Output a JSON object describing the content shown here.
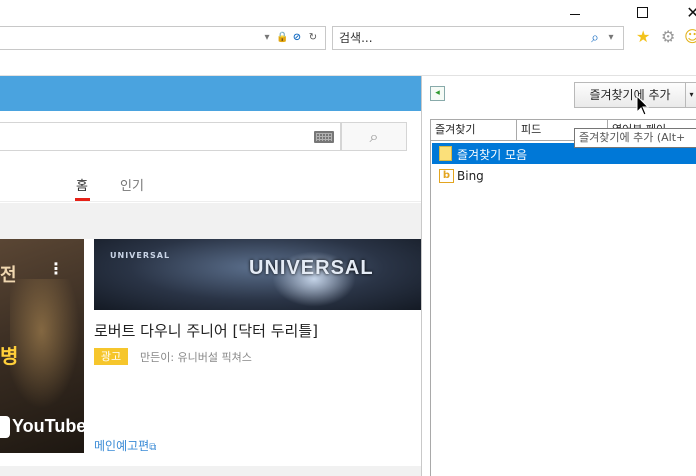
{
  "window": {
    "minimize_icon": "minimize-icon",
    "maximize_icon": "maximize-icon",
    "close_icon": "close-icon",
    "close_glyph": "✕"
  },
  "address_bar": {
    "dropdown_glyph": "▾",
    "lock_glyph": "🔒",
    "blocked_glyph": "⊘",
    "refresh_glyph": "↻"
  },
  "search_bar": {
    "placeholder": "검색...",
    "search_glyph": "⌕",
    "dropdown_glyph": "▾"
  },
  "toolbar_icons": {
    "star_glyph": "★",
    "gear_glyph": "⚙",
    "smiley_glyph": "☺",
    "star_color": "#f3c31c"
  },
  "youtube": {
    "header_color": "#4aa3df",
    "search_glyph": "⌕",
    "tabs": [
      {
        "label": "홈",
        "active": true
      },
      {
        "label": "인기",
        "active": false
      }
    ],
    "video_left": {
      "overlay_text_1": "전",
      "overlay_text_2": "병",
      "menu_glyph": "⋮",
      "logo_text": "YouTube"
    },
    "ad": {
      "thumb_small_logo": "UNIVERSAL",
      "thumb_brand": "UNIVERSAL",
      "title": "로버트 다우니 주니어 [닥터 두리틀]",
      "badge": "광고",
      "channel": "만든이: 유니버설 픽쳐스",
      "link": "메인예고편",
      "link_glyph": "⧉"
    }
  },
  "favorites_pane": {
    "pin_glyph": "◂",
    "add_button": "즐겨찾기에 추가",
    "add_dropdown_glyph": "▾",
    "tabs": [
      "즐겨찾기",
      "피드",
      "열어본 페이"
    ],
    "tooltip": "즐겨찾기에 추가 (Alt+",
    "items": [
      {
        "label": "즐겨찾기 모음",
        "type": "folder",
        "selected": true
      },
      {
        "label": "Bing",
        "type": "link",
        "selected": false
      }
    ],
    "selection_color": "#0078d7"
  }
}
